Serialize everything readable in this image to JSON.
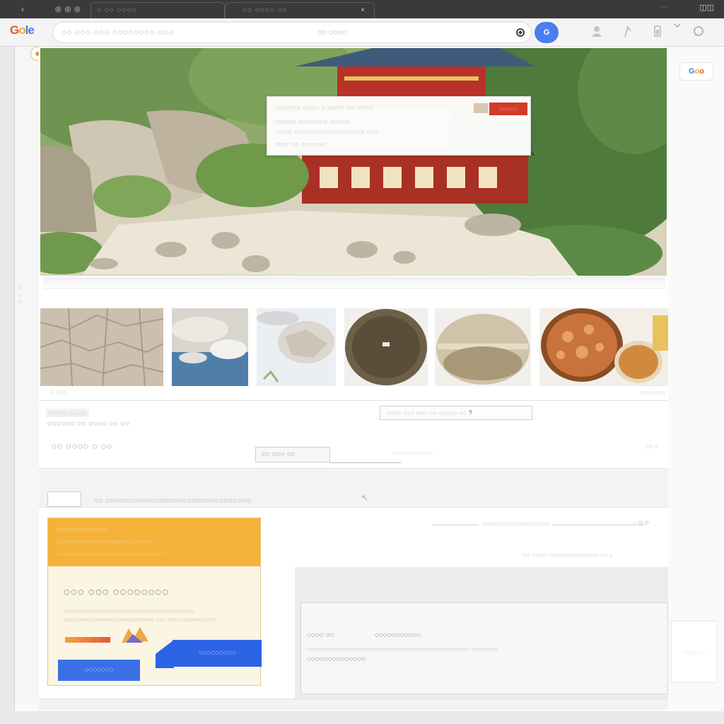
{
  "browser": {
    "back_glyph": "‹",
    "home_tab": "◎ ◎ ◎",
    "tabs": [
      {
        "label": "◌ ◌◌ ◌◌◌◌"
      },
      {
        "label": "◌◌ ◌◌◌◌ ◌◌"
      }
    ],
    "tab_close": "×",
    "window_menu": "⋯",
    "window_right": "◫◫",
    "logo": {
      "g": "G",
      "o1": "o",
      "o2": "le"
    },
    "omnibox_text": "◌◌  ◌◌◌  ◌◌◌ ◌◌◌◌◌◌◌◌ ◌◌◌",
    "omnibox_mid": "◌◌ ◌◌◌◌",
    "go_label": "G",
    "toolbar_icons": [
      "person-icon",
      "pin-icon",
      "battery-icon",
      "chevron-down-icon",
      "chat-icon"
    ]
  },
  "hero": {
    "card_line1": "◌◌◌◌◌◌ ◌◌◌◌  ◌ ◌◌◌◌   ◌◌ ◌◌◌◌",
    "card_line2": "◌◌◌◌◌ ◌◌◌◌◌◌◌ ◌◌◌◌◌",
    "card_line3": "◌◌◌◌ ◌◌◌◌◌◌◌◌◌◌◌◌◌◌◌◌◌ ◌◌◌",
    "card_line4": "◌◌◌  ◌◌ ◌◌◌◌◌◌",
    "card_button": "◌◌◌◌◌"
  },
  "thumbnails": {
    "caption_left": "◌ ◌◌◌",
    "caption_right": "◌◌ ◌◌◌◌"
  },
  "listing": {
    "meta_tag": "◌◌◌◌◌ ◌◌ ◌◌",
    "meta_line": "◌◌◌◌◌◌ ◌◌ ◌◌◌◌ ◌◌ ◌◌",
    "filter_chip": "◌◌◌◌  ◌◌◌ ◌◌◌  ◌◌ ◌◌◌◌◌  ◌◌ ?",
    "rating": "◌◌ ◌◌◌◌ ◌ ◌◌",
    "center_button": "◌◌ ◌◌◌ ◌◌",
    "center_link": "◌◌◌◌◌◌◌◌◌◌◌◌",
    "right_small": "◌◌ ◌"
  },
  "band": {
    "text": "◌◌ ◌◌◌◌◌◌◌◌◌◌◌◌◌◌◌◌◌◌◌◌◌◌◌◌◌◌◌◌◌◌◌◌",
    "arrow": "↖"
  },
  "progress": {
    "label": "◌◌◌◌◌◌◌◌◌◌◌◌◌◌◌◌◌◌",
    "end": "◌",
    "page": "◌  ◌",
    "sub_meta": "◌◌  ◌◌◌◌  ◌◌◌◌◌◌◌◌◌◌◌◌◌  ◌◌  ◌"
  },
  "promo": {
    "line1": "◌◌◌◌◌◌◌◌◌◌◌",
    "line2": "◌◌◌◌◌◌◌◌◌◌◌◌◌◌◌◌◌◌◌◌◌◌◌",
    "line3": "◌◌◌◌◌◌◌◌◌◌◌◌◌◌◌◌◌◌◌◌◌◌◌◌◌◌◌◌◌",
    "title": "◌◌◌  ◌◌◌ ◌◌◌◌◌◌◌◌",
    "desc": "◌◌◌◌◌◌◌◌◌◌◌◌◌◌◌◌◌◌◌◌◌◌◌◌◌◌◌◌◌◌◌◌◌◌◌◌◌◌◌ ◌◌◌◌◌◌◌◌◌◌◌◌◌◌◌◌◌◌◌◌◌◌◌◌◌◌◌ ◌◌◌ ◌◌◌◌ ◌◌◌◌◌◌◌◌◌◌",
    "button_primary": "◌◌◌◌◌◌◌",
    "button_secondary": "◌◌◌◌◌◌◌◌◌"
  },
  "panel": {
    "label_a": "◌◌◌◌ ◌◌",
    "label_b": "◌◌◌◌◌◌◌◌◌◌◌",
    "body": "◌◌◌◌◌◌◌◌◌◌◌◌◌◌◌◌◌◌◌◌◌◌◌◌◌◌◌◌◌◌◌◌◌◌◌◌◌◌◌◌◌◌◌ ◌◌◌◌◌◌◌",
    "footer": "◌◌◌◌◌◌◌◌◌◌◌◌◌◌"
  },
  "rail": {
    "logo": {
      "a": "G",
      "b": "o",
      "c": "o"
    },
    "box_label": "◌◌◌◌◌◌"
  },
  "side_label": "◌◌◌",
  "colors": {
    "accent_blue": "#4a7ef0",
    "promo_orange": "#f4b23a",
    "hero_button_red": "#d43a2a",
    "rating_blue": "#3b4ea0"
  }
}
